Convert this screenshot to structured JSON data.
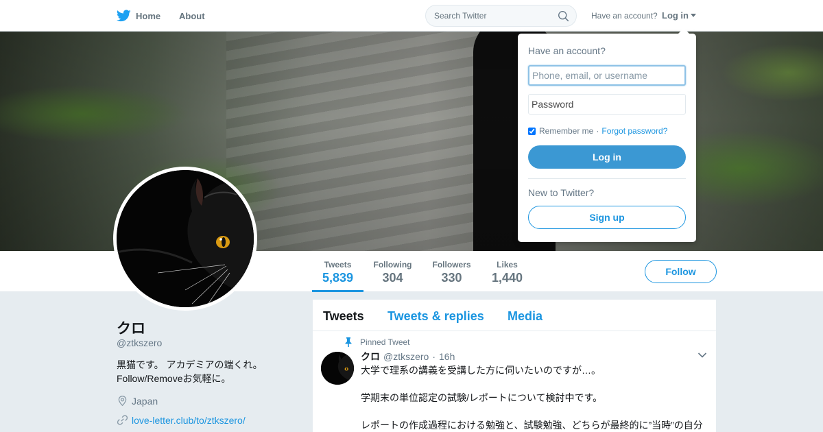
{
  "nav": {
    "home_label": "Home",
    "about_label": "About",
    "search_placeholder": "Search Twitter",
    "have_account": "Have an account?",
    "login_label": "Log in",
    "brand_icon": "twitter-bird-icon"
  },
  "profile": {
    "name": "クロ",
    "handle": "@ztkszero",
    "bio_line1": "黒猫です。 アカデミアの端くれ。",
    "bio_line2": "Follow/Removeお気軽に。",
    "location": "Japan",
    "url": "love-letter.club/to/ztkszero/"
  },
  "stats": [
    {
      "label": "Tweets",
      "value": "5,839"
    },
    {
      "label": "Following",
      "value": "304"
    },
    {
      "label": "Followers",
      "value": "330"
    },
    {
      "label": "Likes",
      "value": "1,440"
    }
  ],
  "follow_label": "Follow",
  "timeline": {
    "tabs": [
      "Tweets",
      "Tweets & replies",
      "Media"
    ],
    "pinned_label": "Pinned Tweet",
    "tweet": {
      "name": "クロ",
      "handle": "@ztkszero",
      "dot": "·",
      "time": "16h",
      "line1": "大学で理系の講義を受講した方に伺いたいのですが…。",
      "line2": "学期末の単位認定の試験/レポートについて検討中です。",
      "line3": "レポートの作成過程における勉強と、試験勉強、どちらが最終的に”当時”の自分"
    }
  },
  "login_dropdown": {
    "heading": "Have an account?",
    "username_placeholder": "Phone, email, or username",
    "password_placeholder": "Password",
    "remember_label": "Remember me",
    "separator": "·",
    "forgot_label": "Forgot password?",
    "login_button": "Log in",
    "new_label": "New to Twitter?",
    "signup_button": "Sign up"
  },
  "colors": {
    "accent": "#1b95e0",
    "login_button": "#3b98d3",
    "muted": "#657786",
    "page_bg": "#e6ecf0"
  }
}
